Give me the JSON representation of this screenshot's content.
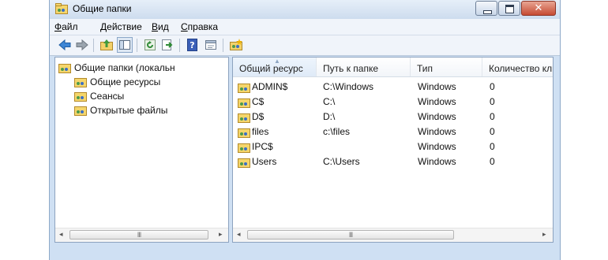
{
  "window": {
    "title": "Общие папки",
    "icon": "shared-folder-icon"
  },
  "menu": [
    {
      "label": "Файл",
      "accel": "Ф",
      "rest": "айл"
    },
    {
      "label": "Действие",
      "accel": "Д",
      "rest": "ействие"
    },
    {
      "label": "Вид",
      "accel": "В",
      "rest": "ид"
    },
    {
      "label": "Справка",
      "accel": "С",
      "rest": "правка"
    }
  ],
  "toolbar": [
    "back-icon",
    "forward-icon",
    "up-folder-icon",
    "show-hide-tree-icon",
    "refresh-icon",
    "export-list-icon",
    "help-icon",
    "properties-icon",
    "new-share-icon"
  ],
  "tree": {
    "root": "Общие папки (локальн",
    "children": [
      "Общие ресурсы",
      "Сеансы",
      "Открытые файлы"
    ]
  },
  "table": {
    "columns": [
      "Общий ресурс",
      "Путь к папке",
      "Тип",
      "Количество клиентских п"
    ],
    "rows": [
      {
        "name": "ADMIN$",
        "path": "C:\\Windows",
        "type": "Windows",
        "clients": "0"
      },
      {
        "name": "C$",
        "path": "C:\\",
        "type": "Windows",
        "clients": "0"
      },
      {
        "name": "D$",
        "path": "D:\\",
        "type": "Windows",
        "clients": "0"
      },
      {
        "name": "files",
        "path": "c:\\files",
        "type": "Windows",
        "clients": "0"
      },
      {
        "name": "IPC$",
        "path": "",
        "type": "Windows",
        "clients": "0"
      },
      {
        "name": "Users",
        "path": "C:\\Users",
        "type": "Windows",
        "clients": "0"
      }
    ]
  },
  "scrollbar": {
    "left": "◂",
    "right": "▸",
    "grip": "III"
  },
  "colors": {
    "frame": "#cfe0f3",
    "border": "#8da3bf",
    "close": "#c64b33"
  }
}
